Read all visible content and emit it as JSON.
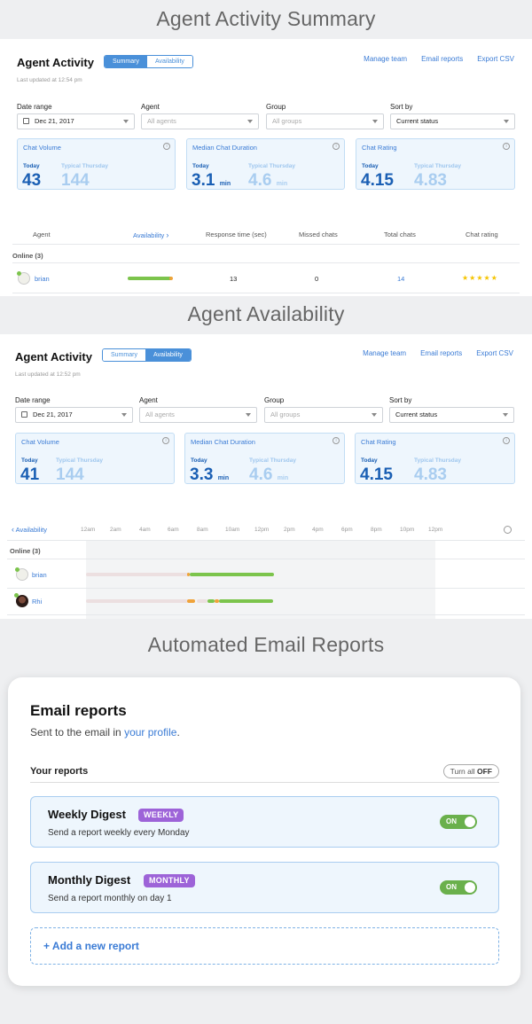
{
  "sections": {
    "summary_title": "Agent Activity Summary",
    "availability_title": "Agent Availability",
    "email_title": "Automated Email Reports"
  },
  "summary": {
    "title": "Agent Activity",
    "tabs": [
      "Summary",
      "Availability"
    ],
    "links": [
      "Manage team",
      "Email reports",
      "Export CSV"
    ],
    "updated": "Last updated at 12:54 pm",
    "filters": {
      "date_label": "Date range",
      "date_value": "Dec 21, 2017",
      "agent_label": "Agent",
      "agent_placeholder": "All agents",
      "group_label": "Group",
      "group_placeholder": "All groups",
      "sort_label": "Sort by",
      "sort_value": "Current status"
    },
    "cards": [
      {
        "title": "Chat Volume",
        "today_label": "Today",
        "typical_label": "Typical Thursday",
        "today": "43",
        "typical": "144",
        "unit": ""
      },
      {
        "title": "Median Chat Duration",
        "today_label": "Today",
        "typical_label": "Typical Thursday",
        "today": "3.1",
        "typical": "4.6",
        "unit": "min"
      },
      {
        "title": "Chat Rating",
        "today_label": "Today",
        "typical_label": "Typical Thursday",
        "today": "4.15",
        "typical": "4.83",
        "unit": ""
      }
    ],
    "table": {
      "headers": [
        "Agent",
        "Availability",
        "Response time (sec)",
        "Missed chats",
        "Total chats",
        "Chat rating"
      ],
      "group": "Online (3)",
      "rows": [
        {
          "name": "brian",
          "response": "13",
          "missed": "0",
          "total": "14",
          "stars": "★★★★★"
        }
      ]
    }
  },
  "availability": {
    "title": "Agent Activity",
    "tabs": [
      "Summary",
      "Availability"
    ],
    "links": [
      "Manage team",
      "Email reports",
      "Export CSV"
    ],
    "updated": "Last updated at 12:52 pm",
    "filters": {
      "date_label": "Date range",
      "date_value": "Dec 21, 2017",
      "agent_label": "Agent",
      "agent_placeholder": "All agents",
      "group_label": "Group",
      "group_placeholder": "All groups",
      "sort_label": "Sort by",
      "sort_value": "Current status"
    },
    "cards": [
      {
        "title": "Chat Volume",
        "today_label": "Today",
        "typical_label": "Typical Thursday",
        "today": "41",
        "typical": "144",
        "unit": ""
      },
      {
        "title": "Median Chat Duration",
        "today_label": "Today",
        "typical_label": "Typical Thursday",
        "today": "3.3",
        "typical": "4.6",
        "unit": "min"
      },
      {
        "title": "Chat Rating",
        "today_label": "Today",
        "typical_label": "Typical Thursday",
        "today": "4.15",
        "typical": "4.83",
        "unit": ""
      }
    ],
    "timeline_label": "Availability",
    "ticks": [
      "12am",
      "2am",
      "4am",
      "6am",
      "8am",
      "10am",
      "12pm",
      "2pm",
      "4pm",
      "6pm",
      "8pm",
      "10pm",
      "12pm"
    ],
    "group": "Online (3)",
    "agents": [
      "brian",
      "Rhi"
    ]
  },
  "email": {
    "title": "Email reports",
    "subtitle_prefix": "Sent to the email in ",
    "subtitle_link": "your profile",
    "subtitle_suffix": ".",
    "your_reports": "Your reports",
    "turn_all_prefix": "Turn all",
    "turn_all_state": "OFF",
    "reports": [
      {
        "name": "Weekly Digest",
        "badge": "WEEKLY",
        "desc": "Send a report weekly every Monday",
        "state": "ON"
      },
      {
        "name": "Monthly Digest",
        "badge": "MONTHLY",
        "desc": "Send a report monthly on day 1",
        "state": "ON"
      }
    ],
    "add": "+ Add a new report"
  },
  "colors": {
    "accent": "#3a7bd5",
    "on_green": "#6ab04c",
    "badge_purple": "#9d63d8",
    "bar_green": "#7cc44c",
    "star": "#f5c400"
  }
}
